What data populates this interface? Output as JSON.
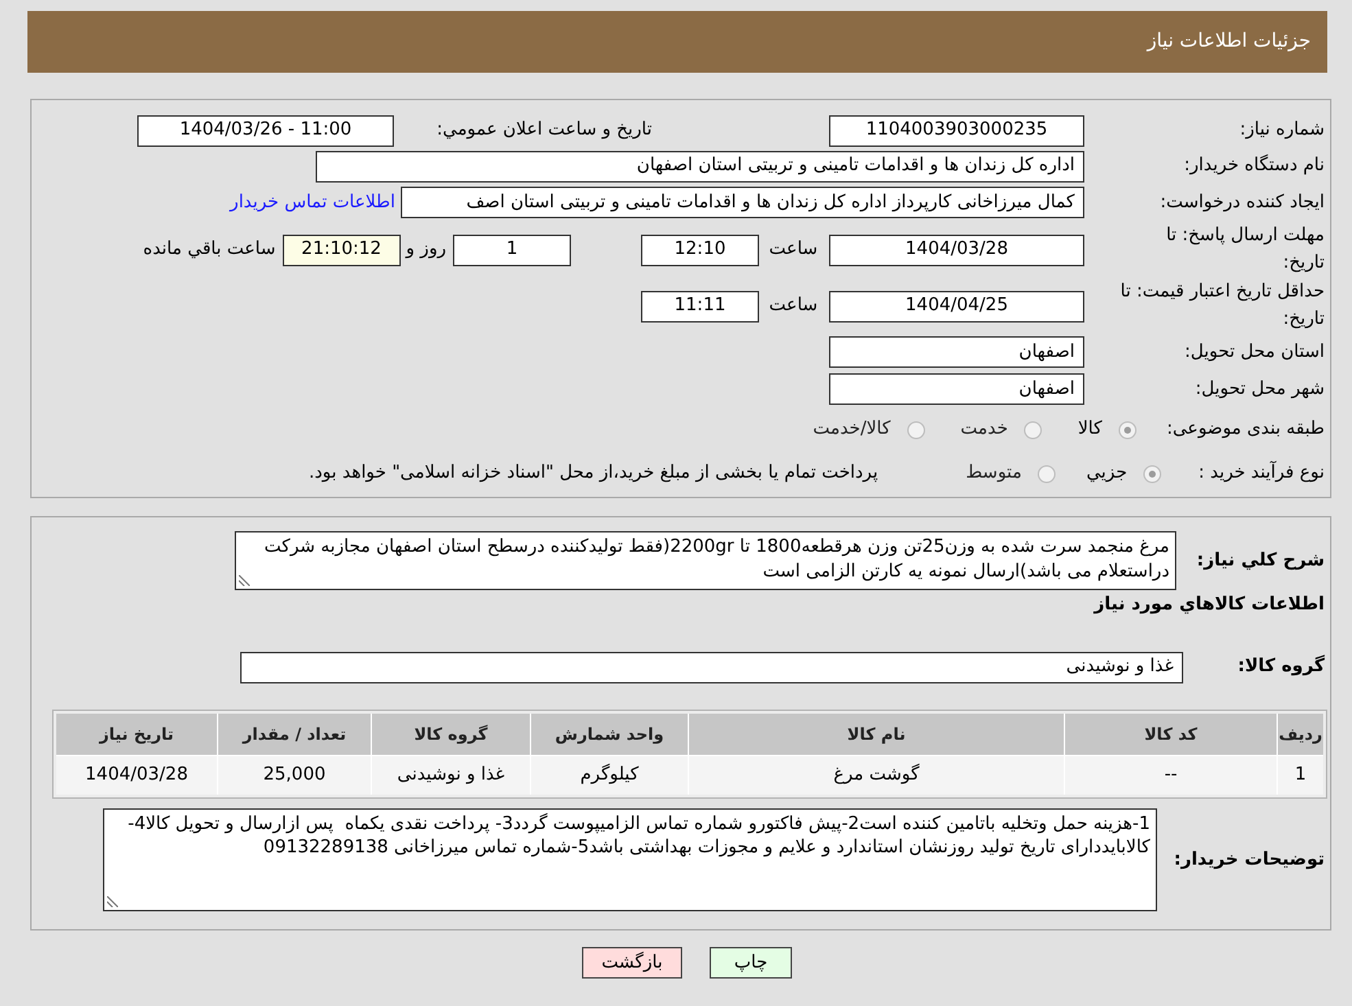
{
  "header": {
    "title": "جزئیات اطلاعات نیاز"
  },
  "details": {
    "need_number": {
      "label": "شماره نیاز:",
      "value": "1104003903000235"
    },
    "announce": {
      "label": "تاريخ و ساعت اعلان عمومي:",
      "value": "1404/03/26 - 11:00"
    },
    "buyer_org": {
      "label": "نام دستگاه خریدار:",
      "value": "اداره کل زندان ها و اقدامات تامینی و تربیتی استان اصفهان"
    },
    "requester": {
      "label": "ایجاد کننده درخواست:",
      "value": "کمال میرزاخانی کارپرداز اداره کل زندان ها و اقدامات تامینی و تربیتی استان اصف",
      "link": "اطلاعات تماس خریدار"
    },
    "reply_deadline": {
      "label": "مهلت ارسال پاسخ: تا تاریخ:",
      "date": "1404/03/28",
      "time_label": "ساعت",
      "time": "12:10",
      "days": "1",
      "days_label": "روز و",
      "remaining": "21:10:12",
      "remaining_label": "ساعت باقي مانده"
    },
    "price_validity": {
      "label": "حداقل تاریخ اعتبار قیمت: تا تاریخ:",
      "date": "1404/04/25",
      "time_label": "ساعت",
      "time": "11:11"
    },
    "province": {
      "label": "استان محل تحویل:",
      "value": "اصفهان"
    },
    "city": {
      "label": "شهر محل تحویل:",
      "value": "اصفهان"
    },
    "category": {
      "label": "طبقه بندی موضوعی:",
      "options": [
        {
          "label": "کالا",
          "selected": true
        },
        {
          "label": "خدمت",
          "selected": false
        },
        {
          "label": "کالا/خدمت",
          "selected": false
        }
      ]
    },
    "process": {
      "label": "نوع فرآیند خرید :",
      "options": [
        {
          "label": "جزيي",
          "selected": true
        },
        {
          "label": "متوسط",
          "selected": false
        }
      ],
      "note": "پرداخت تمام يا بخشی از مبلغ خرید،از محل \"اسناد خزانه اسلامی\" خواهد بود."
    }
  },
  "summary": {
    "label": "شرح كلي نياز:",
    "text": "مرغ منجمد سرت شده به وزن25تن وزن هرقطعه1800 تا 2200gr(فقط تولیدکننده درسطح استان اصفهان مجازبه شرکت دراستعلام می باشد)ارسال نمونه یه کارتن الزامی است"
  },
  "goods": {
    "heading": "اطلاعات كالاهاي مورد نياز",
    "group_label": "گروه کالا:",
    "group_value": "غذا و نوشیدنی",
    "table": {
      "columns": [
        "ردیف",
        "کد کالا",
        "نام کالا",
        "واحد شمارش",
        "گروه کالا",
        "تعداد / مقدار",
        "تاریخ نیاز"
      ],
      "rows": [
        {
          "cells": [
            "1",
            "--",
            "گوشت مرغ",
            "کیلوگرم",
            "غذا و نوشیدنی",
            "25,000",
            "1404/03/28"
          ]
        }
      ]
    }
  },
  "buyer_notes": {
    "label": "توضیحات خریدار:",
    "text": "1-هزینه حمل وتخلیه باتامین کننده است2-پیش فاکتورو شماره تماس الزامیپوست گردد3- پرداخت نقدی یکماه  پس ازارسال و تحویل کالا4-کالابایددارای تاریخ تولید روزنشان استاندارد و علایم و مجوزات بهداشتی باشد5-شماره تماس میرزاخانی 09132289138"
  },
  "buttons": [
    {
      "label": "چاپ",
      "kind": "print"
    },
    {
      "label": "بازگشت",
      "kind": "back"
    }
  ]
}
